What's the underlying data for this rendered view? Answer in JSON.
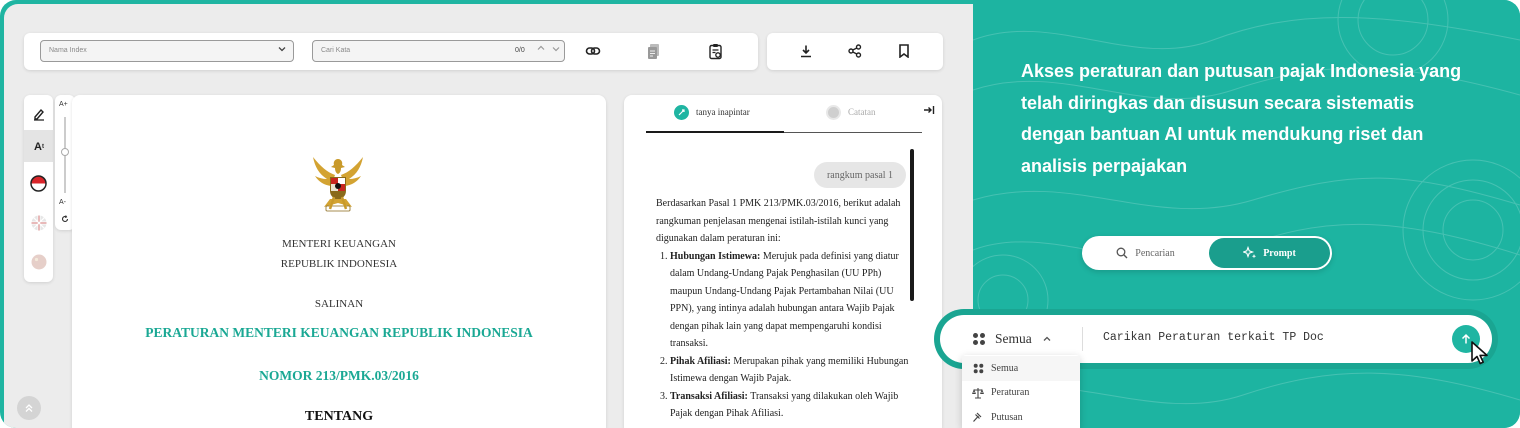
{
  "toolbar": {
    "index_placeholder": "Nama Index",
    "search_placeholder": "Cari Kata",
    "match_count": "0/0"
  },
  "side_tools": {
    "font_increase": "A+",
    "font_decrease": "A-"
  },
  "document": {
    "line1": "MENTERI KEUANGAN",
    "line2": "REPUBLIK INDONESIA",
    "line3": "SALINAN",
    "title": "PERATURAN MENTERI KEUANGAN REPUBLIK INDONESIA",
    "number": "NOMOR 213/PMK.03/2016",
    "about": "TENTANG"
  },
  "chat": {
    "tab_ai": "tanya inapintar",
    "tab_notes": "Catatan",
    "user_message": "rangkum pasal 1",
    "intro": "Berdasarkan Pasal 1 PMK 213/PMK.03/2016, berikut adalah rangkuman penjelasan mengenai istilah-istilah kunci yang digunakan dalam peraturan ini:",
    "items": [
      {
        "term": "Hubungan Istimewa:",
        "desc": "Merujuk pada definisi yang diatur dalam Undang-Undang Pajak Penghasilan (UU PPh) maupun Undang-Undang Pajak Pertambahan Nilai (UU PPN), yang intinya adalah hubungan antara Wajib Pajak dengan pihak lain yang dapat mempengaruhi kondisi transaksi."
      },
      {
        "term": "Pihak Afiliasi:",
        "desc": "Merupakan pihak yang memiliki Hubungan Istimewa dengan Wajib Pajak."
      },
      {
        "term": "Transaksi Afiliasi:",
        "desc": "Transaksi yang dilakukan oleh Wajib Pajak dengan Pihak Afiliasi."
      }
    ]
  },
  "promo": {
    "headline": "Akses peraturan dan putusan pajak Indonesia yang telah diringkas dan disusun secara sistematis dengan bantuan AI untuk mendukung riset dan analisis perpajakan",
    "mode_search": "Pencarian",
    "mode_prompt": "Prompt",
    "category_selected": "Semua",
    "query": "Carikan Peraturan terkait TP Doc",
    "dropdown": [
      "Semua",
      "Peraturan",
      "Putusan"
    ]
  },
  "colors": {
    "accent": "#1fb5a2",
    "accent_dark": "#169b8a",
    "doc_title": "#1aa894"
  }
}
